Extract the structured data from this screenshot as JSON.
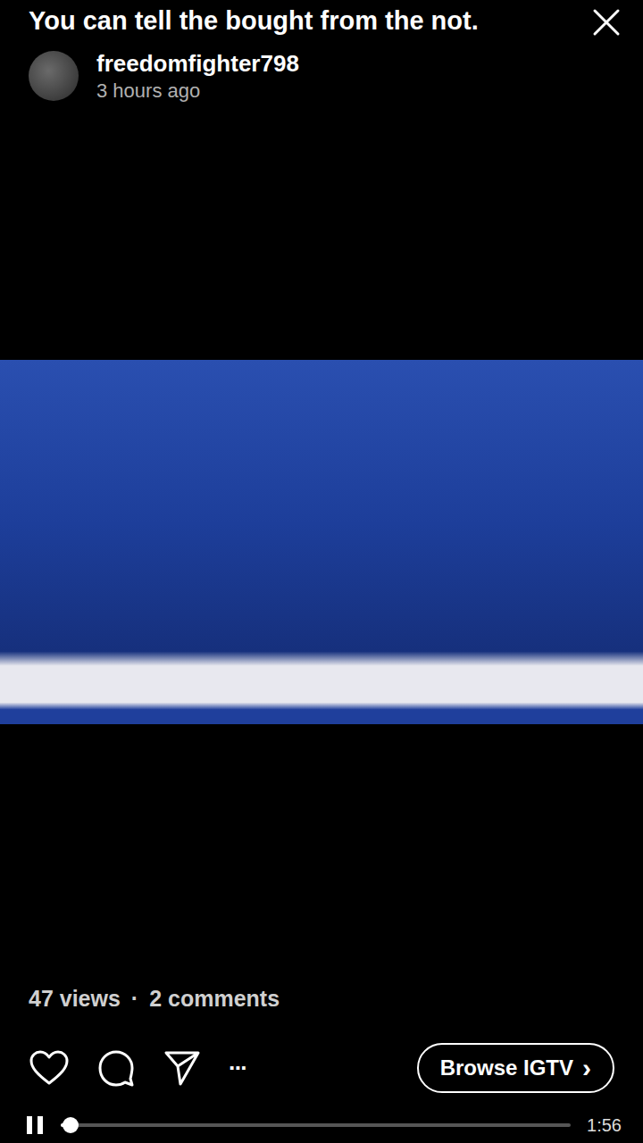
{
  "post": {
    "title": "You can tell the bought from the not.",
    "username": "freedomfighter798",
    "time": "3 hours ago"
  },
  "video": {
    "playing": true,
    "progress": 0.02,
    "duration": "1:56"
  },
  "stats": {
    "views": "47 views",
    "separator": "·",
    "comments": "2 comments"
  },
  "actions": {
    "more": "···",
    "browse": "Browse IGTV",
    "browse_chevron": "›"
  }
}
